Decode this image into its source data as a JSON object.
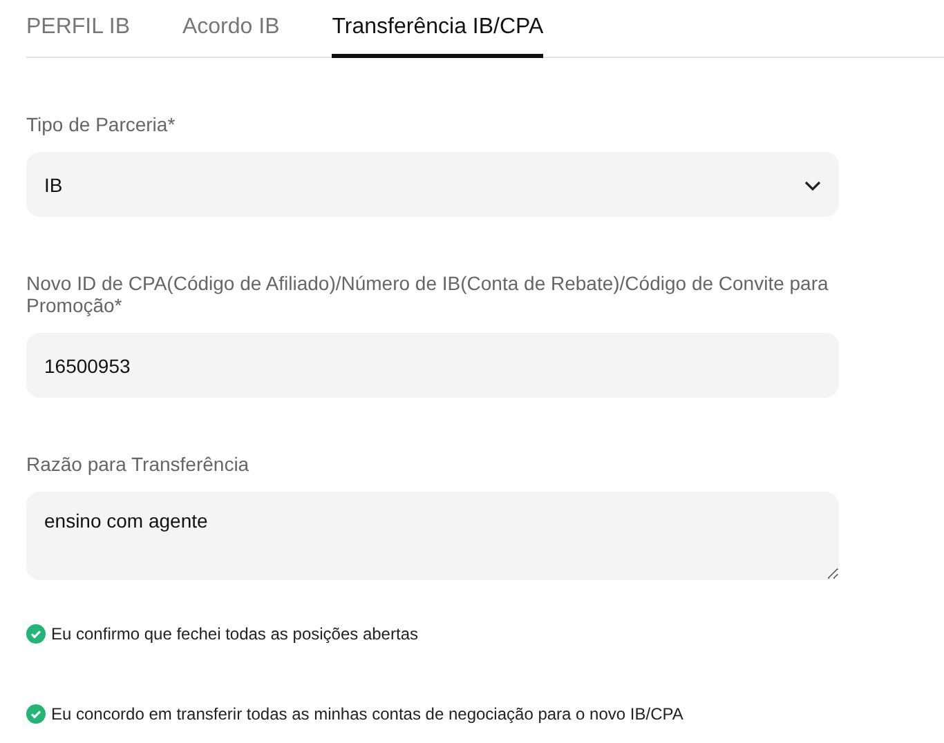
{
  "tabs": [
    {
      "label": "PERFIL IB",
      "selected": false
    },
    {
      "label": "Acordo IB",
      "selected": false
    },
    {
      "label": "Transferência IB/CPA",
      "selected": true
    }
  ],
  "form": {
    "fields": [
      {
        "kind": "select",
        "label": "Tipo de Parceria*",
        "value": "IB"
      },
      {
        "kind": "input",
        "label": "Novo ID de CPA(Código de Afiliado)/Número de IB(Conta de Rebate)/Código de Convite para Promoção*",
        "value": "16500953"
      },
      {
        "kind": "textarea",
        "label": "Razão para Transferência",
        "value": "ensino com agente"
      }
    ],
    "confirmations": [
      {
        "text": "Eu confirmo que fechei todas as posições abertas",
        "checked": true
      },
      {
        "text": "Eu concordo em transferir todas as minhas contas de negociação para o novo IB/CPA",
        "checked": true
      }
    ]
  }
}
